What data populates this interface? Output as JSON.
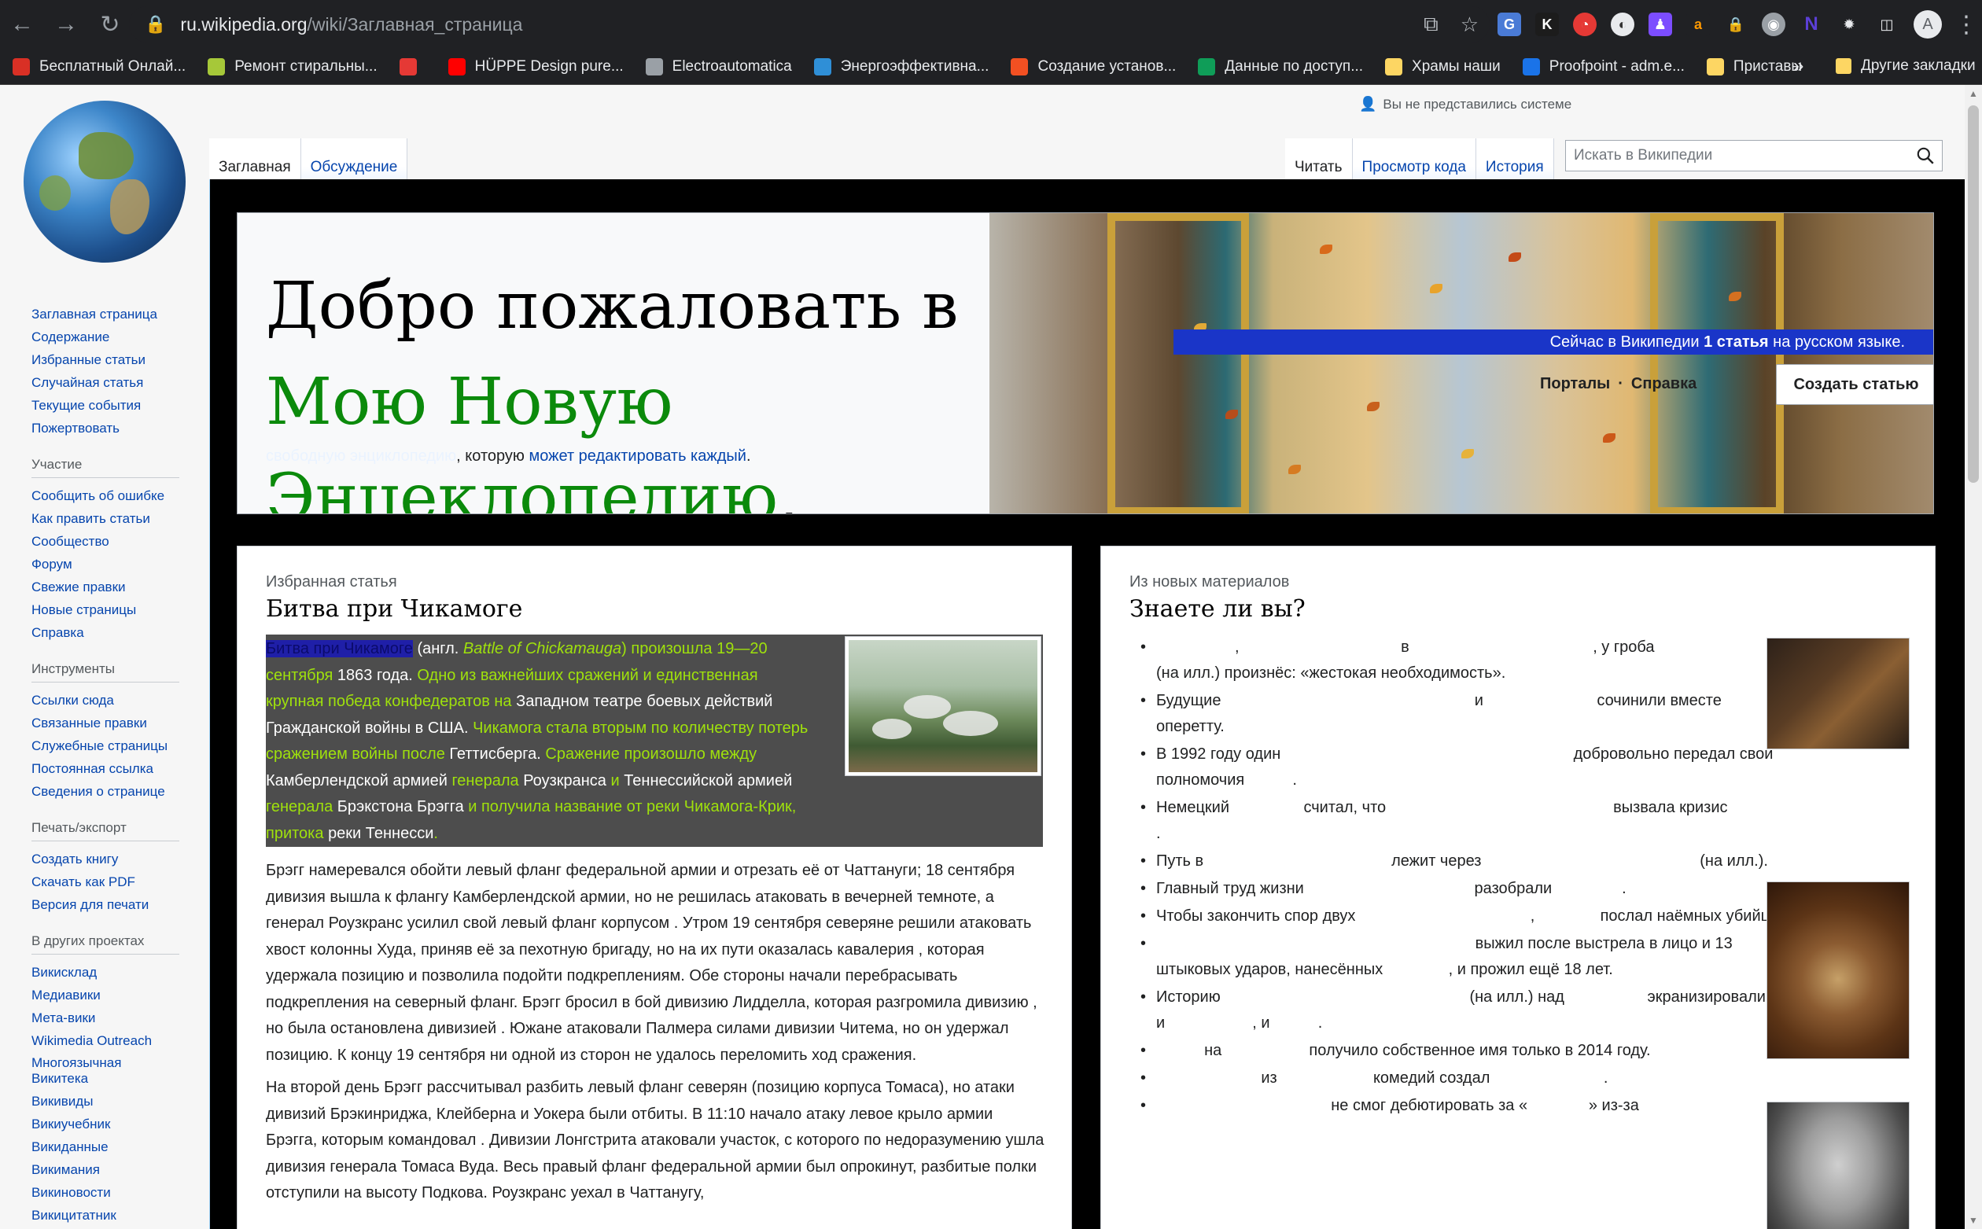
{
  "browser": {
    "url_host": "ru.wikipedia.org",
    "url_path": "/wiki/Заглавная_страница",
    "profile_initial": "A",
    "bookmarks": [
      {
        "label": "Бесплатный Онлай...",
        "icon": "bookmark-red-icon",
        "color": "#d93025"
      },
      {
        "label": "Ремонт стиральны...",
        "icon": "triangle-icon",
        "color": "#a6c839"
      },
      {
        "label": "",
        "icon": "s-circle-icon",
        "color": "#e53935"
      },
      {
        "label": "HÜPPE Design pure...",
        "icon": "youtube-icon",
        "color": "#ff0000"
      },
      {
        "label": "Electroautomatica",
        "icon": "globe-icon",
        "color": "#9aa0a6"
      },
      {
        "label": "Энергоэффективна...",
        "icon": "diamond-icon",
        "color": "#2f8fd7"
      },
      {
        "label": "Создание установ...",
        "icon": "windows-icon",
        "color": "#f25022"
      },
      {
        "label": "Данные по доступ...",
        "icon": "sheets-icon",
        "color": "#0f9d58"
      },
      {
        "label": "Храмы наши",
        "icon": "folder-icon",
        "color": "#fdd663"
      },
      {
        "label": "Proofpoint - adm.e...",
        "icon": "proofpoint-icon",
        "color": "#1a73e8"
      },
      {
        "label": "Приставы",
        "icon": "folder-icon",
        "color": "#fdd663"
      }
    ],
    "bookmarks_more": "»",
    "bookmarks_other": "Другие закладки"
  },
  "wiki": {
    "personal": "Вы не представились системе",
    "tabs_left": [
      "Заглавная",
      "Обсуждение"
    ],
    "tabs_right": [
      "Читать",
      "Просмотр кода",
      "История"
    ],
    "search_placeholder": "Искать в Википедии",
    "sidebar": {
      "nav": [
        "Заглавная страница",
        "Содержание",
        "Избранные статьи",
        "Случайная статья",
        "Текущие события",
        "Пожертвовать"
      ],
      "participation_heading": "Участие",
      "participation": [
        "Сообщить об ошибке",
        "Как править статьи",
        "Сообщество",
        "Форум",
        "Свежие правки",
        "Новые страницы",
        "Справка"
      ],
      "tools_heading": "Инструменты",
      "tools": [
        "Ссылки сюда",
        "Связанные правки",
        "Служебные страницы",
        "Постоянная ссылка",
        "Сведения о странице"
      ],
      "print_heading": "Печать/экспорт",
      "print": [
        "Создать книгу",
        "Скачать как PDF",
        "Версия для печати"
      ],
      "projects_heading": "В других проектах",
      "projects": [
        "Викисклад",
        "Медиавики",
        "Мета-вики",
        "Wikimedia Outreach",
        "Многоязычная Викитека",
        "Викивиды",
        "Викиучебник",
        "Викиданные",
        "Викимания",
        "Викиновости",
        "Викицитатник"
      ]
    },
    "banner": {
      "welcome_black": "Добро пожаловать в ",
      "welcome_green": "Мою Новую Энцеклопедию",
      "welcome_comma": ",",
      "sub_faint": "свободную энциклопедию",
      "sub_mid": ", которую ",
      "sub_link": "может редактировать каждый",
      "sub_end": ".",
      "stat_pre": "Сейчас в Википедии ",
      "stat_bold": "1 статья",
      "stat_post": " на русском языке.",
      "link_portals": "Порталы",
      "link_sep": "·",
      "link_help": "Справка",
      "create_button": "Создать статью"
    },
    "featured": {
      "label": "Избранная статья",
      "title": "Битва при Чикамоге",
      "lead": [
        {
          "t": "Битва при Чикамоге",
          "c": "b"
        },
        {
          "t": " (англ. ",
          "c": "w"
        },
        {
          "t": "Battle of Chickamauga",
          "c": "lk ital"
        },
        {
          "t": ") произошла 19—20 сентября ",
          "c": "lk"
        },
        {
          "t": "1863 года. ",
          "c": "w"
        },
        {
          "t": "Одно из важнейших сражений и единственная крупная победа конфедератов на ",
          "c": "lk"
        },
        {
          "t": "Западном театре боевых действий Гражданской войны в США. ",
          "c": "w"
        },
        {
          "t": "Чикамога стала вторым по количеству потерь сражением войны после ",
          "c": "lk"
        },
        {
          "t": "Геттисберга. ",
          "c": "w"
        },
        {
          "t": "Сражение произошло между ",
          "c": "lk"
        },
        {
          "t": "Камберлендской армией ",
          "c": "w"
        },
        {
          "t": "генерала ",
          "c": "lk"
        },
        {
          "t": "Роузкранса ",
          "c": "w"
        },
        {
          "t": "и ",
          "c": "lk"
        },
        {
          "t": "Теннессийской армией ",
          "c": "w"
        },
        {
          "t": "генерала ",
          "c": "lk"
        },
        {
          "t": "Брэкстона Брэгга ",
          "c": "w"
        },
        {
          "t": "и получила название от реки Чикамога-Крик, притока ",
          "c": "lk"
        },
        {
          "t": "реки Теннесси",
          "c": "w"
        },
        {
          "t": ".",
          "c": "lk"
        }
      ],
      "para1": "Брэгг намеревался обойти левый фланг федеральной армии и отрезать её от Чаттануги; 18 сентября дивизия                     вышла к флангу Камберлендской армии, но не решилась атаковать в вечерней темноте, а генерал Роузкранс усилил свой левый фланг корпусом              . Утром 19 сентября северяне решили атаковать хвост колонны Худа, приняв её за пехотную бригаду, но на их пути оказалась кавалерия                 , которая удержала позицию и позволила подойти подкреплениям. Обе стороны начали перебрасывать подкрепления на северный фланг. Брэгг бросил в бой дивизию Лидделла, которая разгромила дивизию                           , но была остановлена дивизией                . Южане атаковали Палмера силами дивизии Читема, но он удержал позицию. К концу 19 сентября ни одной из сторон не удалось переломить ход сражения.",
      "para2": "На второй день Брэгг рассчитывал разбить левый фланг северян (позицию корпуса Томаса), но атаки дивизий Брэкинриджа, Клейберна и Уокера были отбиты. В 11:10 начало атаку левое крыло армии Брэгга, которым командовал                          . Дивизии Лонгстрита атаковали участок, с которого по недоразумению ушла дивизия генерала Томаса Вуда. Весь правый фланг федеральной армии был опрокинут, разбитые полки отступили на высоту Подкова. Роузкранс уехал в Чаттанугу,"
    },
    "dyk": {
      "label": "Из новых материалов",
      "title": "Знаете ли вы?",
      "items": [
        "                  ,                                     в                                          , у гроба                                              (на илл.) произнёс: «жестокая необходимость».",
        "Будущие                                                          и                          сочинили вместе оперетту.",
        "В 1992 году один                                                                   добровольно передал свои полномочия           .",
        "Немецкий                 считал, что                                                    вызвала кризис                                                                       .",
        "Путь в                                           лежит через                                                  (на илл.).",
        "Главный труд жизни                                       разобрали                .",
        "Чтобы закончить спор двух                                        ,               послал наёмных убийц.",
        "                                                                         выжил после выстрела в лицо и 13 штыковых ударов, нанесённых               , и прожил ещё 18 лет.",
        "Историю                                                         (на илл.) над                   экранизировали и                    , и           .",
        "           на                    получило собственное имя только в 2014 году.",
        "                        из                      комедий создал                          .",
        "                                        не смог дебютировать за «              » из-за"
      ]
    }
  }
}
